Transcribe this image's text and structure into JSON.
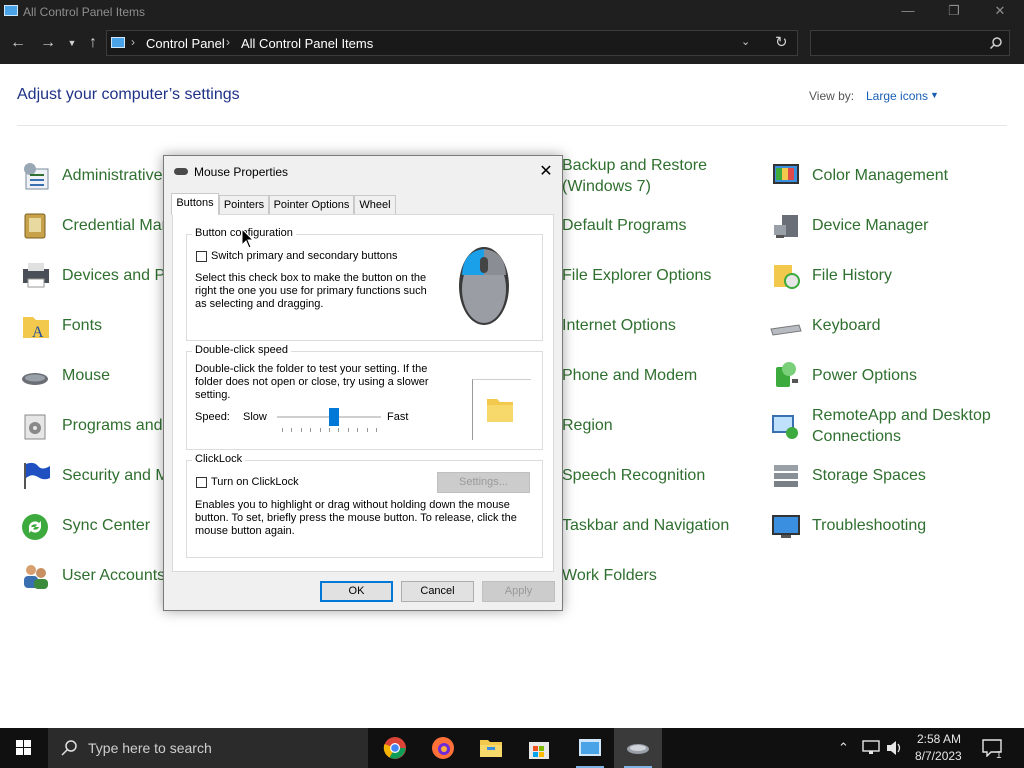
{
  "window": {
    "title": "All Control Panel Items",
    "controls": {
      "minimize": "—",
      "restore": "❐",
      "close": "✕"
    }
  },
  "address_bar": {
    "breadcrumbs": [
      "Control Panel",
      "All Control Panel Items"
    ],
    "search_placeholder": ""
  },
  "main": {
    "heading": "Adjust your computer’s settings",
    "view_by_label": "View by:",
    "view_by_value": "Large icons"
  },
  "control_panel_items": {
    "col1": [
      "Administrative",
      "Credential Mar",
      "Devices and Pr",
      "Fonts",
      "Mouse",
      "Programs and",
      "Security and M",
      "Sync Center",
      "User Accounts"
    ],
    "col3": [
      "Backup and Restore",
      "(Windows 7)",
      "Default Programs",
      "File Explorer Options",
      "Internet Options",
      "Phone and Modem",
      "Region",
      "Speech Recognition",
      "Taskbar and Navigation",
      "Work Folders"
    ],
    "col4": [
      "Color Management",
      "Device Manager",
      "File History",
      "Keyboard",
      "Power Options",
      "RemoteApp and Desktop",
      "Connections",
      "Storage Spaces",
      "Troubleshooting"
    ]
  },
  "dialog": {
    "title": "Mouse Properties",
    "tabs": [
      "Buttons",
      "Pointers",
      "Pointer Options",
      "Wheel"
    ],
    "active_tab": "Buttons",
    "button_config": {
      "group_title": "Button configuration",
      "checkbox_label": "Switch primary and secondary buttons",
      "checked": false,
      "desc_lines": [
        "Select this check box to make the button on the",
        "right the one you use for primary functions such",
        "as selecting and dragging."
      ]
    },
    "double_click": {
      "group_title": "Double-click speed",
      "desc_lines": [
        "Double-click the folder to test your setting. If the",
        "folder does not open or close, try using a slower",
        "setting."
      ],
      "speed_label": "Speed:",
      "slow_label": "Slow",
      "fast_label": "Fast",
      "speed_value": 0.55
    },
    "clicklock": {
      "group_title": "ClickLock",
      "checkbox_label": "Turn on ClickLock",
      "checked": false,
      "settings_button": "Settings...",
      "desc_lines": [
        "Enables you to highlight or drag without holding down the mouse",
        "button. To set, briefly press the mouse button. To release, click the",
        "mouse button again."
      ]
    },
    "buttons": {
      "ok": "OK",
      "cancel": "Cancel",
      "apply": "Apply"
    }
  },
  "taskbar": {
    "search_placeholder": "Type here to search",
    "time": "2:58 AM",
    "date": "8/7/2023",
    "notification_count": "1"
  },
  "colors": {
    "link_green": "#2f6f2f",
    "heading_blue": "#1e3287",
    "accent_blue": "#0078d7",
    "chrome_dark": "#1f1f1f"
  }
}
